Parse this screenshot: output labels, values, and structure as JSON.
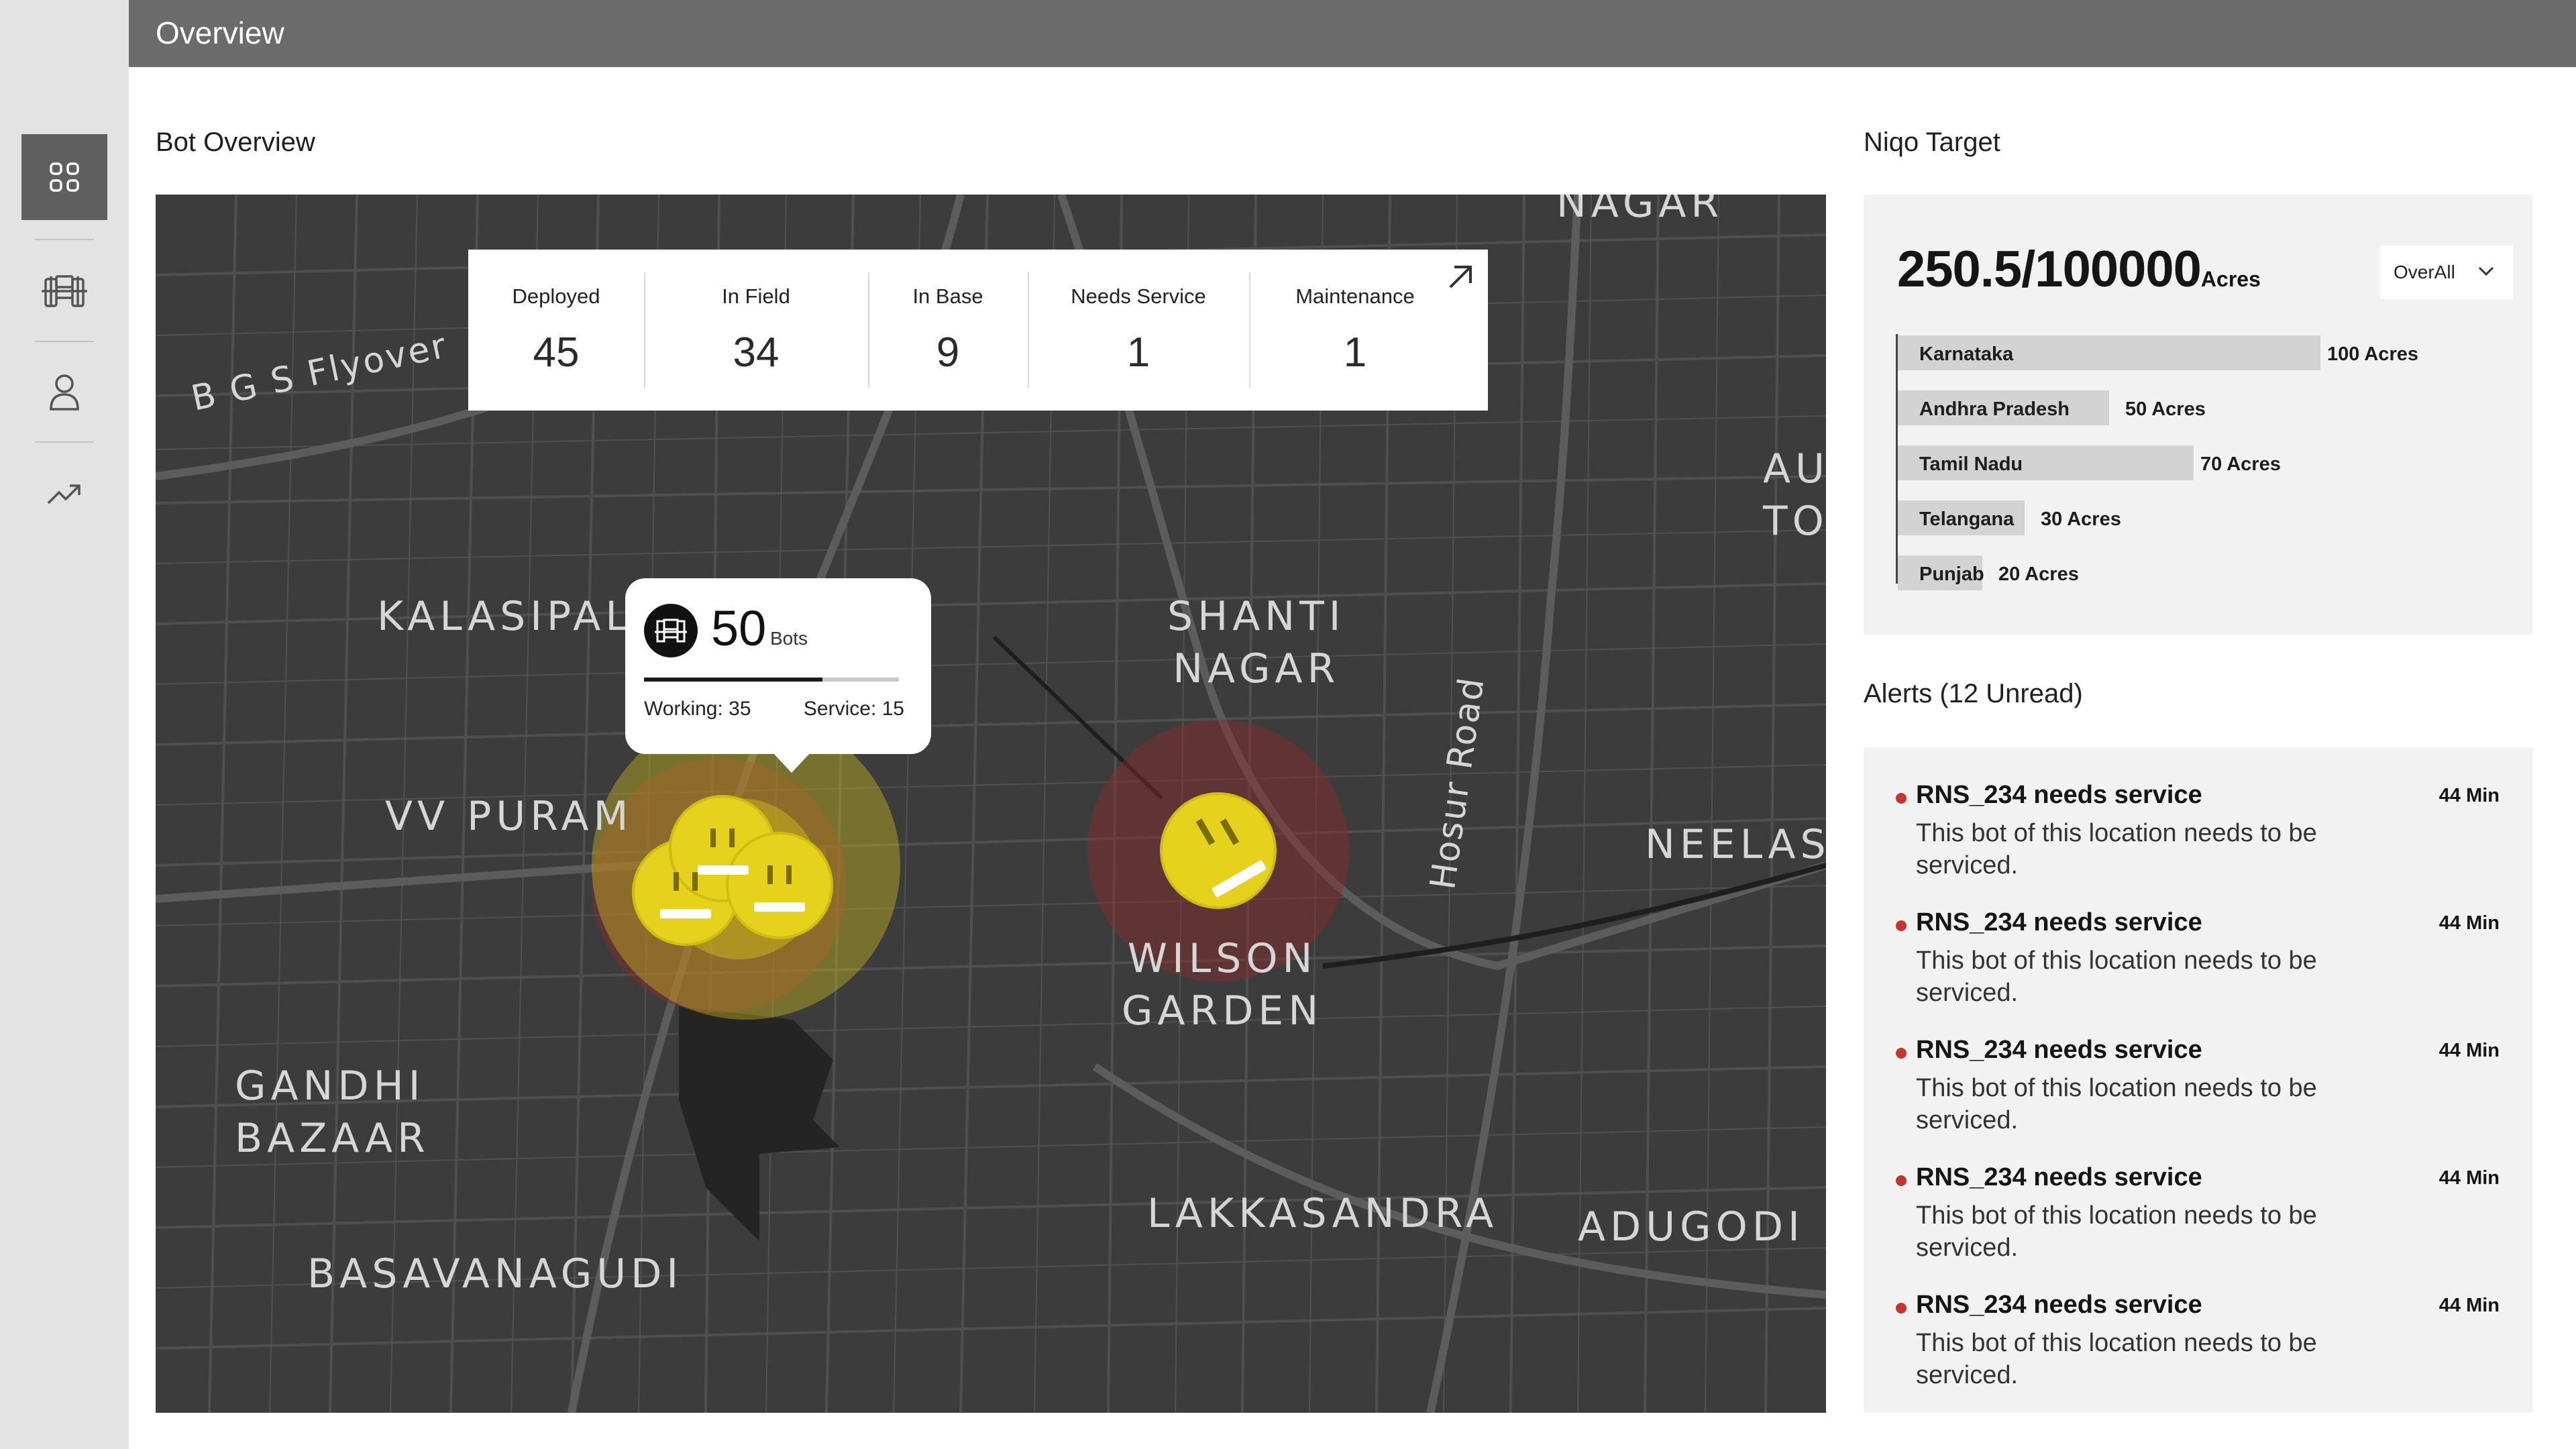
{
  "header": {
    "title": "Overview"
  },
  "sidebar": {
    "items": [
      {
        "icon": "grid-icon",
        "active": true
      },
      {
        "icon": "bot-icon",
        "active": false
      },
      {
        "icon": "user-icon",
        "active": false
      },
      {
        "icon": "trending-up-icon",
        "active": false
      }
    ]
  },
  "bot_overview": {
    "title": "Bot Overview",
    "stats": [
      {
        "label": "Deployed",
        "value": "45"
      },
      {
        "label": "In Field",
        "value": "34"
      },
      {
        "label": "In Base",
        "value": "9"
      },
      {
        "label": "Needs Service",
        "value": "1"
      },
      {
        "label": "Maintenance",
        "value": "1"
      }
    ],
    "popup": {
      "count": "50",
      "unit": "Bots",
      "working": "Working: 35",
      "service": "Service: 15",
      "working_fraction": 0.7
    },
    "map_labels": {
      "bgs": "B G S Flyover",
      "kalasipalya": "KALASIPALY",
      "shanti": "SHANTI\nNAGAR",
      "vvpuram": "VV PURAM",
      "wilson": "WILSON\nGARDEN",
      "gandhi": "GANDHI\nBAZAAR",
      "basavanagudi": "BASAVANAGUDI",
      "lakkasandra": "LAKKASANDRA",
      "adugodi": "ADUGODI",
      "neelasa": "NEELASA",
      "hosur": "Hosur Road",
      "nagar": "NAGAR",
      "au": "AU\nTO"
    },
    "colors": {
      "map_bg": "#3c3c3c",
      "bot_yellow": "#e6d21d",
      "alert_red": "#c8322f"
    }
  },
  "target": {
    "title": "Niqo Target",
    "value": "250.5/100000",
    "unit": "Acres",
    "dropdown": "OverAll",
    "states": [
      {
        "name": "Karnataka",
        "value": 100,
        "label": "100 Acres"
      },
      {
        "name": "Andhra Pradesh",
        "value": 50,
        "label": "50 Acres"
      },
      {
        "name": "Tamil Nadu",
        "value": 70,
        "label": "70 Acres"
      },
      {
        "name": "Telangana",
        "value": 30,
        "label": "30 Acres"
      },
      {
        "name": "Punjab",
        "value": 20,
        "label": "20 Acres"
      }
    ]
  },
  "alerts": {
    "title": "Alerts (12 Unread)",
    "items": [
      {
        "title": "RNS_234 needs service",
        "message": "This bot of this location needs to be serviced.",
        "time": "44 Min"
      },
      {
        "title": "RNS_234 needs service",
        "message": "This bot of this location needs to be serviced.",
        "time": "44 Min"
      },
      {
        "title": "RNS_234 needs service",
        "message": "This bot of this location needs to be serviced.",
        "time": "44 Min"
      },
      {
        "title": "RNS_234 needs service",
        "message": "This bot of this location needs to be serviced.",
        "time": "44 Min"
      },
      {
        "title": "RNS_234 needs service",
        "message": "This bot of this location needs to be serviced.",
        "time": "44 Min"
      }
    ]
  }
}
